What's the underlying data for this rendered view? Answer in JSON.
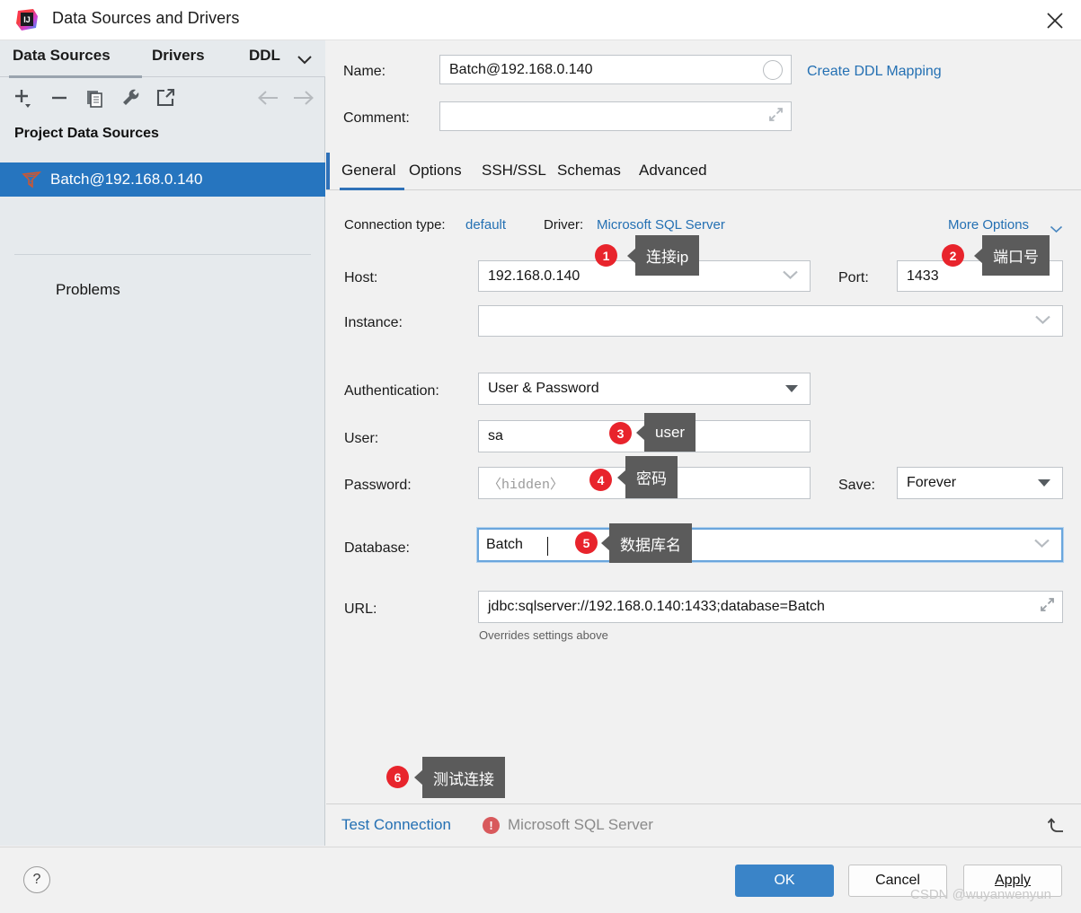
{
  "window": {
    "title": "Data Sources and Drivers",
    "app_icon": "intellij-idea-logo",
    "close_icon": "close-icon"
  },
  "sidebar": {
    "tabs": [
      {
        "label": "Data Sources",
        "active": true
      },
      {
        "label": "Drivers",
        "active": false
      },
      {
        "label": "DDL",
        "active": false
      }
    ],
    "tabs_overflow_icon": "chevron-down-icon",
    "toolbar": [
      {
        "icon": "add-icon",
        "name": "add-data-source-button"
      },
      {
        "icon": "remove-icon",
        "name": "remove-data-source-button"
      },
      {
        "icon": "duplicate-icon",
        "name": "duplicate-data-source-button"
      },
      {
        "icon": "wrench-icon",
        "name": "properties-button"
      },
      {
        "icon": "external-link-icon",
        "name": "open-external-button"
      },
      {
        "icon": "arrow-left-icon",
        "name": "navigate-back-button"
      },
      {
        "icon": "arrow-right-icon",
        "name": "navigate-forward-button"
      }
    ],
    "group_header": "Project Data Sources",
    "items": [
      {
        "label": "Batch@192.168.0.140",
        "icon": "sqlserver-icon",
        "selected": true
      }
    ],
    "problems_label": "Problems"
  },
  "form": {
    "name_label": "Name:",
    "name_value": "Batch@192.168.0.140",
    "color_indicator_icon": "color-circle-icon",
    "create_ddl_mapping_link": "Create DDL Mapping",
    "comment_label": "Comment:",
    "comment_value": "",
    "comment_expand_icon": "expand-icon"
  },
  "tabs": {
    "items": [
      {
        "label": "General",
        "active": true
      },
      {
        "label": "Options",
        "active": false
      },
      {
        "label": "SSH/SSL",
        "active": false
      },
      {
        "label": "Schemas",
        "active": false
      },
      {
        "label": "Advanced",
        "active": false
      }
    ]
  },
  "general": {
    "connection_type_label": "Connection type:",
    "connection_type_value": "default",
    "driver_label": "Driver:",
    "driver_value": "Microsoft SQL Server",
    "more_options_link": "More Options",
    "more_options_icon": "chevron-down-icon",
    "host_label": "Host:",
    "host_value": "192.168.0.140",
    "host_dropdown_icon": "chevron-down-icon",
    "port_label": "Port:",
    "port_value": "1433",
    "instance_label": "Instance:",
    "instance_value": "",
    "instance_dropdown_icon": "chevron-down-icon",
    "authentication_label": "Authentication:",
    "authentication_value": "User & Password",
    "authentication_dropdown_icon": "triangle-down-icon",
    "user_label": "User:",
    "user_value": "sa",
    "password_label": "Password:",
    "password_placeholder": "〈hidden〉",
    "save_label": "Save:",
    "save_value": "Forever",
    "save_dropdown_icon": "triangle-down-icon",
    "database_label": "Database:",
    "database_value": "Batch",
    "database_dropdown_icon": "chevron-down-icon",
    "url_label": "URL:",
    "url_value": "jdbc:sqlserver://192.168.0.140:1433;database=Batch",
    "url_expand_icon": "expand-icon",
    "url_hint": "Overrides settings above"
  },
  "status": {
    "test_connection_link": "Test Connection",
    "warning_icon": "error-badge-icon",
    "warning_glyph": "!",
    "driver_name": "Microsoft SQL Server",
    "revert_icon": "revert-arrow-icon"
  },
  "footer": {
    "help_label": "?",
    "ok_label": "OK",
    "cancel_label": "Cancel",
    "apply_label": "Apply"
  },
  "watermark": "CSDN @wuyanwenyun",
  "annotations": [
    {
      "number": "1",
      "text": "连接ip"
    },
    {
      "number": "2",
      "text": "端口号"
    },
    {
      "number": "3",
      "text": "user"
    },
    {
      "number": "4",
      "text": "密码"
    },
    {
      "number": "5",
      "text": "数据库名"
    },
    {
      "number": "6",
      "text": "测试连接"
    }
  ],
  "colors": {
    "accent_blue": "#2675bf",
    "link_blue": "#2470b3",
    "badge_red": "#e8242c",
    "callout_gray": "#5b5b5b",
    "sidebar_bg": "#e6eaed"
  }
}
